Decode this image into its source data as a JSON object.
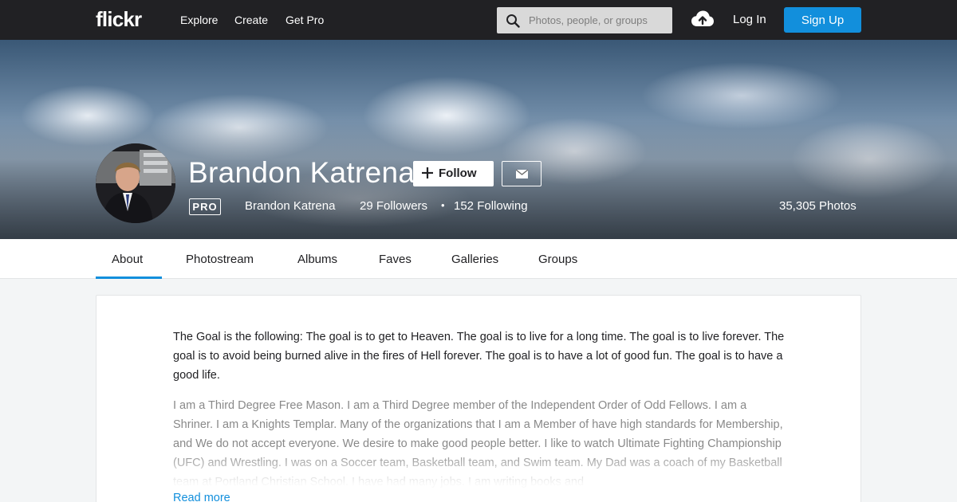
{
  "header": {
    "logo": "flickr",
    "nav": [
      "Explore",
      "Create",
      "Get Pro"
    ],
    "search_placeholder": "Photos, people, or groups",
    "login": "Log In",
    "signup": "Sign Up"
  },
  "profile": {
    "name": "Brandon Katrena",
    "follow_label": "Follow",
    "pro_badge": "PRO",
    "real_name": "Brandon Katrena",
    "followers": "29 Followers",
    "following": "152 Following",
    "separator": "•",
    "photos": "35,305 Photos"
  },
  "tabs": [
    "About",
    "Photostream",
    "Albums",
    "Faves",
    "Galleries",
    "Groups"
  ],
  "about": {
    "bio_primary": "The Goal is the following: The goal is to get to Heaven. The goal is to live for a long time. The goal is to live forever. The goal is to avoid being burned alive in the fires of Hell forever. The goal is to have a lot of good fun. The goal is to have a good life.",
    "bio_secondary": "I am a Third Degree Free Mason. I am a Third Degree member of the Independent Order of Odd Fellows. I am a Shriner. I am a Knights Templar. Many of the organizations that I am a Member of have high standards for Membership, and We do not accept everyone. We desire to make good people better. I like to watch Ultimate Fighting Championship (UFC) and Wrestling. I was on a Soccer team, Basketball team, and Swim team. My Dad was a coach of my Basketball team at Portland Christian School. I have had many jobs. I am writing books and",
    "read_more": "Read more"
  },
  "colors": {
    "nav_bg": "#212124",
    "accent": "#128fdc",
    "page_bg": "#f3f5f6"
  },
  "icons": [
    "search-icon",
    "upload-cloud-icon",
    "plus-icon",
    "mail-icon"
  ]
}
